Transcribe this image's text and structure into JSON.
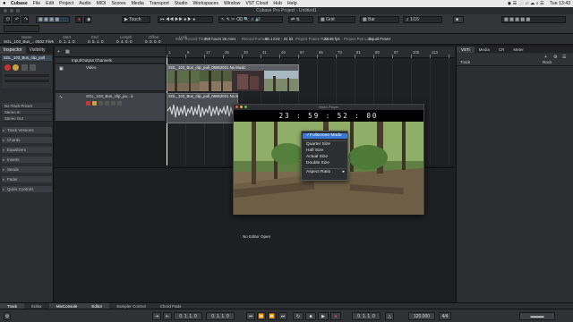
{
  "menubar": {
    "app": "Cubase",
    "items": [
      "File",
      "Edit",
      "Project",
      "Audio",
      "MIDI",
      "Scores",
      "Media",
      "Transport",
      "Studio",
      "Workspaces",
      "Window",
      "VST Cloud",
      "Hub",
      "Help"
    ],
    "clock": "Tue 13:43"
  },
  "window": {
    "title": "Cubase Pro Project - Untitled1"
  },
  "toolbar": {
    "mode": "Touch",
    "snap_type": "Grid",
    "grid_unit": "Bar",
    "quantize": "1/16"
  },
  "infoline": {
    "headers": [
      "Name",
      "Start",
      "End",
      "Length",
      "Offset",
      "Lock"
    ],
    "values": [
      "SGL_103_Bus_...0502 FileMusic",
      "0. 1. 1. 0",
      "0. 5. 1. 0",
      "0. 4. 0. 0",
      "0. 0. 0. 0",
      ""
    ],
    "status": [
      {
        "label": "Max. Record Time",
        "value": "269 hours 36 mins"
      },
      {
        "label": "Record Format",
        "value": "96.1 kHz - 24 bit"
      },
      {
        "label": "Project Frame Rate",
        "value": "23.98 fps"
      },
      {
        "label": "Project Pan Law",
        "value": "Equal Power"
      }
    ]
  },
  "inspector": {
    "tabs": [
      "Inspector",
      "Visibility"
    ],
    "track_name": "SGL_103_Bus_clip_pull",
    "readonly": [
      "No Track Preset",
      "Stereo In",
      "Stereo Out"
    ],
    "sections": [
      "Track Versions",
      "Chords",
      "Equalizers",
      "Inserts",
      "Sends",
      "Fader",
      "Quick Controls"
    ]
  },
  "tracks": {
    "folder": "Input/Output Channels",
    "video_track": "Video",
    "audio_track": "SGL_103_Bus_clip_pu...ic"
  },
  "ruler": {
    "marks": [
      "1",
      "9",
      "17",
      "25",
      "33",
      "41",
      "49",
      "57",
      "65",
      "73",
      "81",
      "89",
      "97",
      "105",
      "113"
    ]
  },
  "clips": {
    "video": "SGL_103_Bus_clip_pull_06062021 No Music",
    "audio": "SGL_103_Bus_clip_pull_06062021 No Music"
  },
  "lower_zone": {
    "message": "No Editor Open"
  },
  "right_zone": {
    "tabs": [
      "VSTi",
      "Media",
      "CR",
      "Meter"
    ],
    "track_label": "Track",
    "rack_label": "Rack"
  },
  "bottom_tabs": [
    "Track",
    "Editor",
    "MixConsole",
    "Editor",
    "Sampler Control",
    "Chord Pads"
  ],
  "player": {
    "title": "Video Player",
    "timecode": "23 : 59 : 52 : 00"
  },
  "context_menu": {
    "items": [
      "Fullscreen Mode",
      "Quarter Size",
      "Half Size",
      "Actual Size",
      "Double Size",
      "Aspect Ratio"
    ],
    "checked_index": 0
  },
  "transport": {
    "left_locator": "0. 1. 1. 0",
    "right_locator": "0. 1. 1. 0",
    "position": "0. 1. 1. 0",
    "tempo": "120.000",
    "signature": "4/4"
  },
  "colors": {
    "accent": "#3a78d6",
    "record": "#d33",
    "track_header": "#3d4a5a"
  }
}
